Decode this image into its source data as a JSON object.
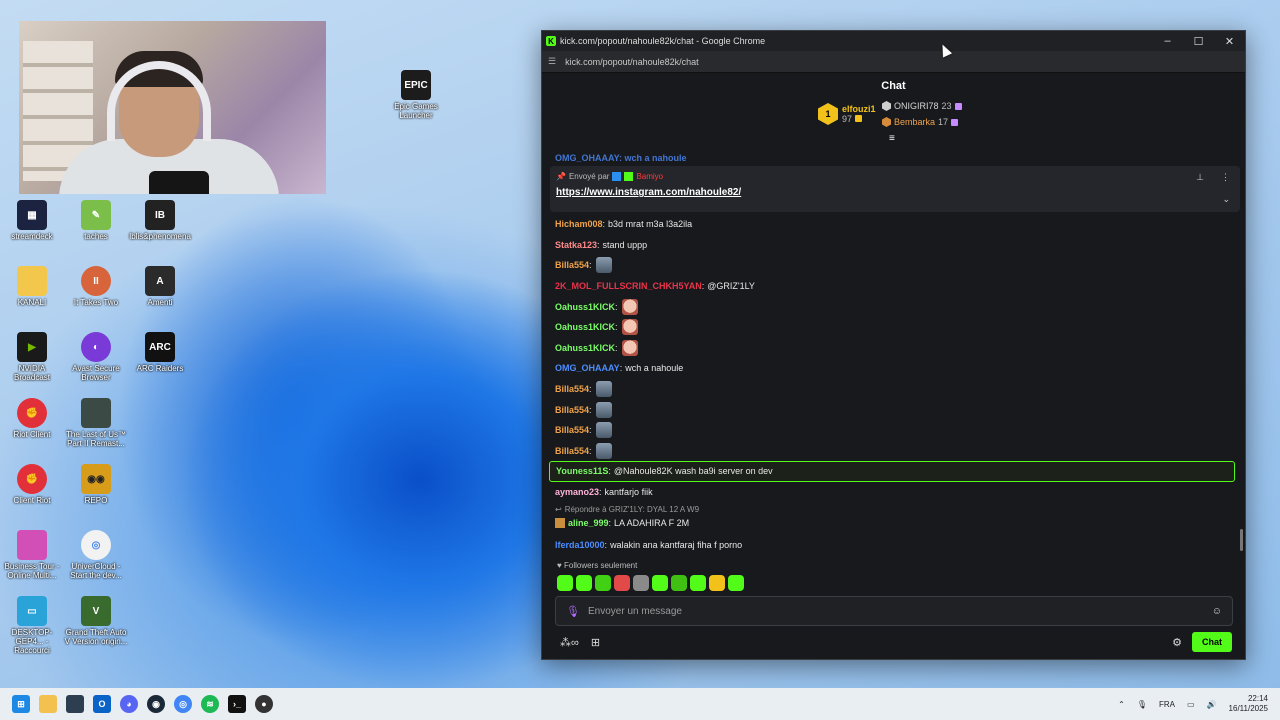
{
  "window": {
    "title": "kick.com/popout/nahoule82k/chat - Google Chrome",
    "url": "kick.com/popout/nahoule82k/chat"
  },
  "chat": {
    "header": "Chat",
    "leaderboard": [
      {
        "rank": "1",
        "name": "elfouzi1",
        "count": "97"
      },
      {
        "name": "ONIGIRI78",
        "count": "23"
      },
      {
        "name": "Bembarka",
        "count": "17"
      }
    ],
    "partial_top": "OMG_OHAAAY: wch a nahoule",
    "pinned": {
      "sent_by_label": "Envoyé par",
      "sender": "Bamiyo",
      "link": "https://www.instagram.com/nahoule82/"
    },
    "messages": [
      {
        "user": "Hicham008",
        "color": "#f0a24a",
        "text": "b3d mrat m3a l3a2ila"
      },
      {
        "user": "Statka123",
        "color": "#ff8a8a",
        "text": "stand uppp"
      },
      {
        "user": "Billa554",
        "color": "#f0a24a",
        "text": "",
        "emote": "robot"
      },
      {
        "user": "2K_MOL_FULLSCRIN_CHKH5YAN",
        "color": "#e8344a",
        "text": "@GRIZ'1LY"
      },
      {
        "user": "Oahuss1KICK",
        "color": "#7cfc6a",
        "text": "",
        "emote": "face"
      },
      {
        "user": "Oahuss1KICK",
        "color": "#7cfc6a",
        "text": "",
        "emote": "face"
      },
      {
        "user": "Oahuss1KICK",
        "color": "#7cfc6a",
        "text": "",
        "emote": "face"
      },
      {
        "user": "OMG_OHAAAY",
        "color": "#4d8dff",
        "text": "wch a nahoule"
      },
      {
        "user": "Billa554",
        "color": "#f0a24a",
        "text": "",
        "emote": "robot"
      },
      {
        "user": "Billa554",
        "color": "#f0a24a",
        "text": "",
        "emote": "robot"
      },
      {
        "user": "Billa554",
        "color": "#f0a24a",
        "text": "",
        "emote": "robot"
      },
      {
        "user": "Billa554",
        "color": "#f0a24a",
        "text": "",
        "emote": "robot"
      },
      {
        "user": "Youness11S",
        "color": "#7cfc6a",
        "text": "@Nahoule82K wash ba9i server on dev",
        "highlight": true
      },
      {
        "user": "aymano23",
        "color": "#ffb3d9",
        "text": "kantfarjo fiik"
      },
      {
        "reply_to": "Répondre à GRIZ'1LY: DYAL 12 A W9",
        "user": "aline_999",
        "color": "#7cfc6a",
        "text": "LA ADAHIRA F 2M"
      },
      {
        "user": "lferda10000",
        "color": "#4d8dff",
        "text": "walakin ana kantfaraj fiha f porno"
      }
    ],
    "followers_only": "Followers seulement",
    "input_placeholder": "Envoyer un message",
    "send_button": "Chat"
  },
  "desktop_icons": [
    {
      "label": "streamdeck"
    },
    {
      "label": "taches"
    },
    {
      "label": "Iblis&phenomena"
    },
    {
      "label": "KANALI"
    },
    {
      "label": "It Takes Two"
    },
    {
      "label": "Amenti"
    },
    {
      "label": "NVIDIA Broadcast"
    },
    {
      "label": "Avast Secure Browser"
    },
    {
      "label": "ARC Raiders"
    },
    {
      "label": "Riot Client"
    },
    {
      "label": "The Last of Us™ Part II Remast..."
    },
    {
      "label": "Client Riot"
    },
    {
      "label": "REPO"
    },
    {
      "label": "Business Tour - Online Multi..."
    },
    {
      "label": "UniverCloud - Start the dev..."
    },
    {
      "label": "DESKTOP-GEP4... - Raccourci"
    },
    {
      "label": "Grand Theft Auto V Version origin..."
    },
    {
      "label": "Epic Games Launcher"
    }
  ],
  "taskbar": {
    "lang": "FRA",
    "time": "22:14",
    "date": "16/11/2025"
  }
}
